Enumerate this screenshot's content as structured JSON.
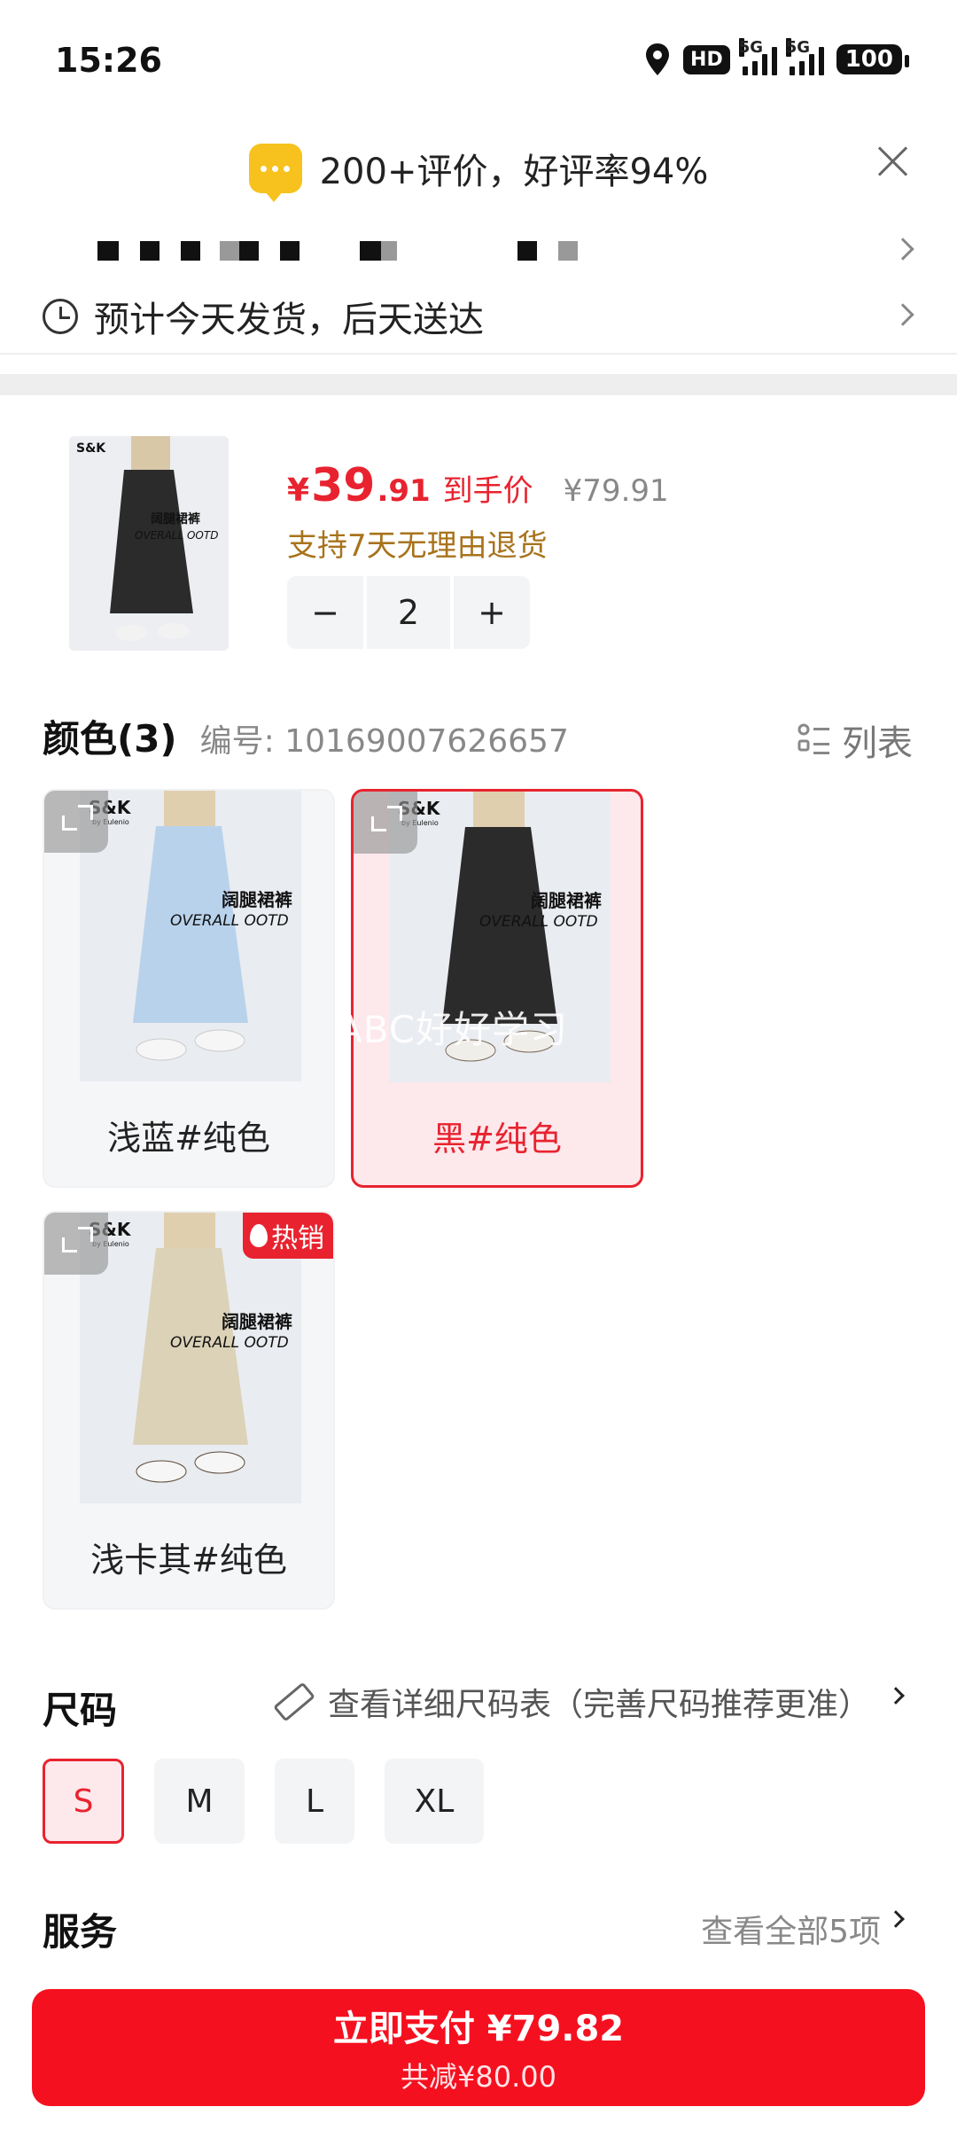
{
  "status_bar": {
    "time": "15:26",
    "hd": "HD",
    "net1": "5G",
    "net2": "5G",
    "battery": "100"
  },
  "review_banner": {
    "text": "200+评价，好评率94%"
  },
  "shipping": {
    "text": "预计今天发货，后天送达"
  },
  "product": {
    "price_currency": "¥",
    "price_int": "39",
    "price_dec": ".91",
    "price_label": "到手价",
    "original_price": "¥79.91",
    "return_policy": "支持7天无理由退货",
    "quantity": "2",
    "minus": "−",
    "plus": "+",
    "thumb_brand": "S&K",
    "thumb_text1": "阔腿裙裤",
    "thumb_text2": "OVERALL OOTD"
  },
  "color_section": {
    "title": "颜色(3)",
    "code": "编号: 10169007626657",
    "list_label": "列表",
    "options": [
      {
        "label": "浅蓝#纯色",
        "brand": "S&K",
        "brand_sub": "by Eulenio",
        "text1": "阔腿裙裤",
        "text2": "OVERALL OOTD",
        "pants_color": "#b9d2ec",
        "selected": false
      },
      {
        "label": "黑#纯色",
        "brand": "S&K",
        "brand_sub": "by Eulenio",
        "text1": "阔腿裙裤",
        "text2": "OVERALL OOTD",
        "pants_color": "#2b2b2b",
        "selected": true
      },
      {
        "label": "浅卡其#纯色",
        "brand": "S&K",
        "brand_sub": "by Eulenio",
        "text1": "阔腿裙裤",
        "text2": "OVERALL OOTD",
        "pants_color": "#dcd2b8",
        "selected": false,
        "badge": "热销"
      }
    ]
  },
  "watermark": "ABC好好学习",
  "size_section": {
    "title": "尺码",
    "chart_link": "查看详细尺码表（完善尺码推荐更准）",
    "options": [
      "S",
      "M",
      "L",
      "XL"
    ],
    "selected": "S"
  },
  "service_section": {
    "title": "服务",
    "link": "查看全部5项"
  },
  "pay_button": {
    "main": "立即支付 ¥79.82",
    "sub": "共减¥80.00"
  },
  "colors": {
    "accent": "#e8232f",
    "pay": "#f5101f",
    "return_text": "#a8731c"
  }
}
